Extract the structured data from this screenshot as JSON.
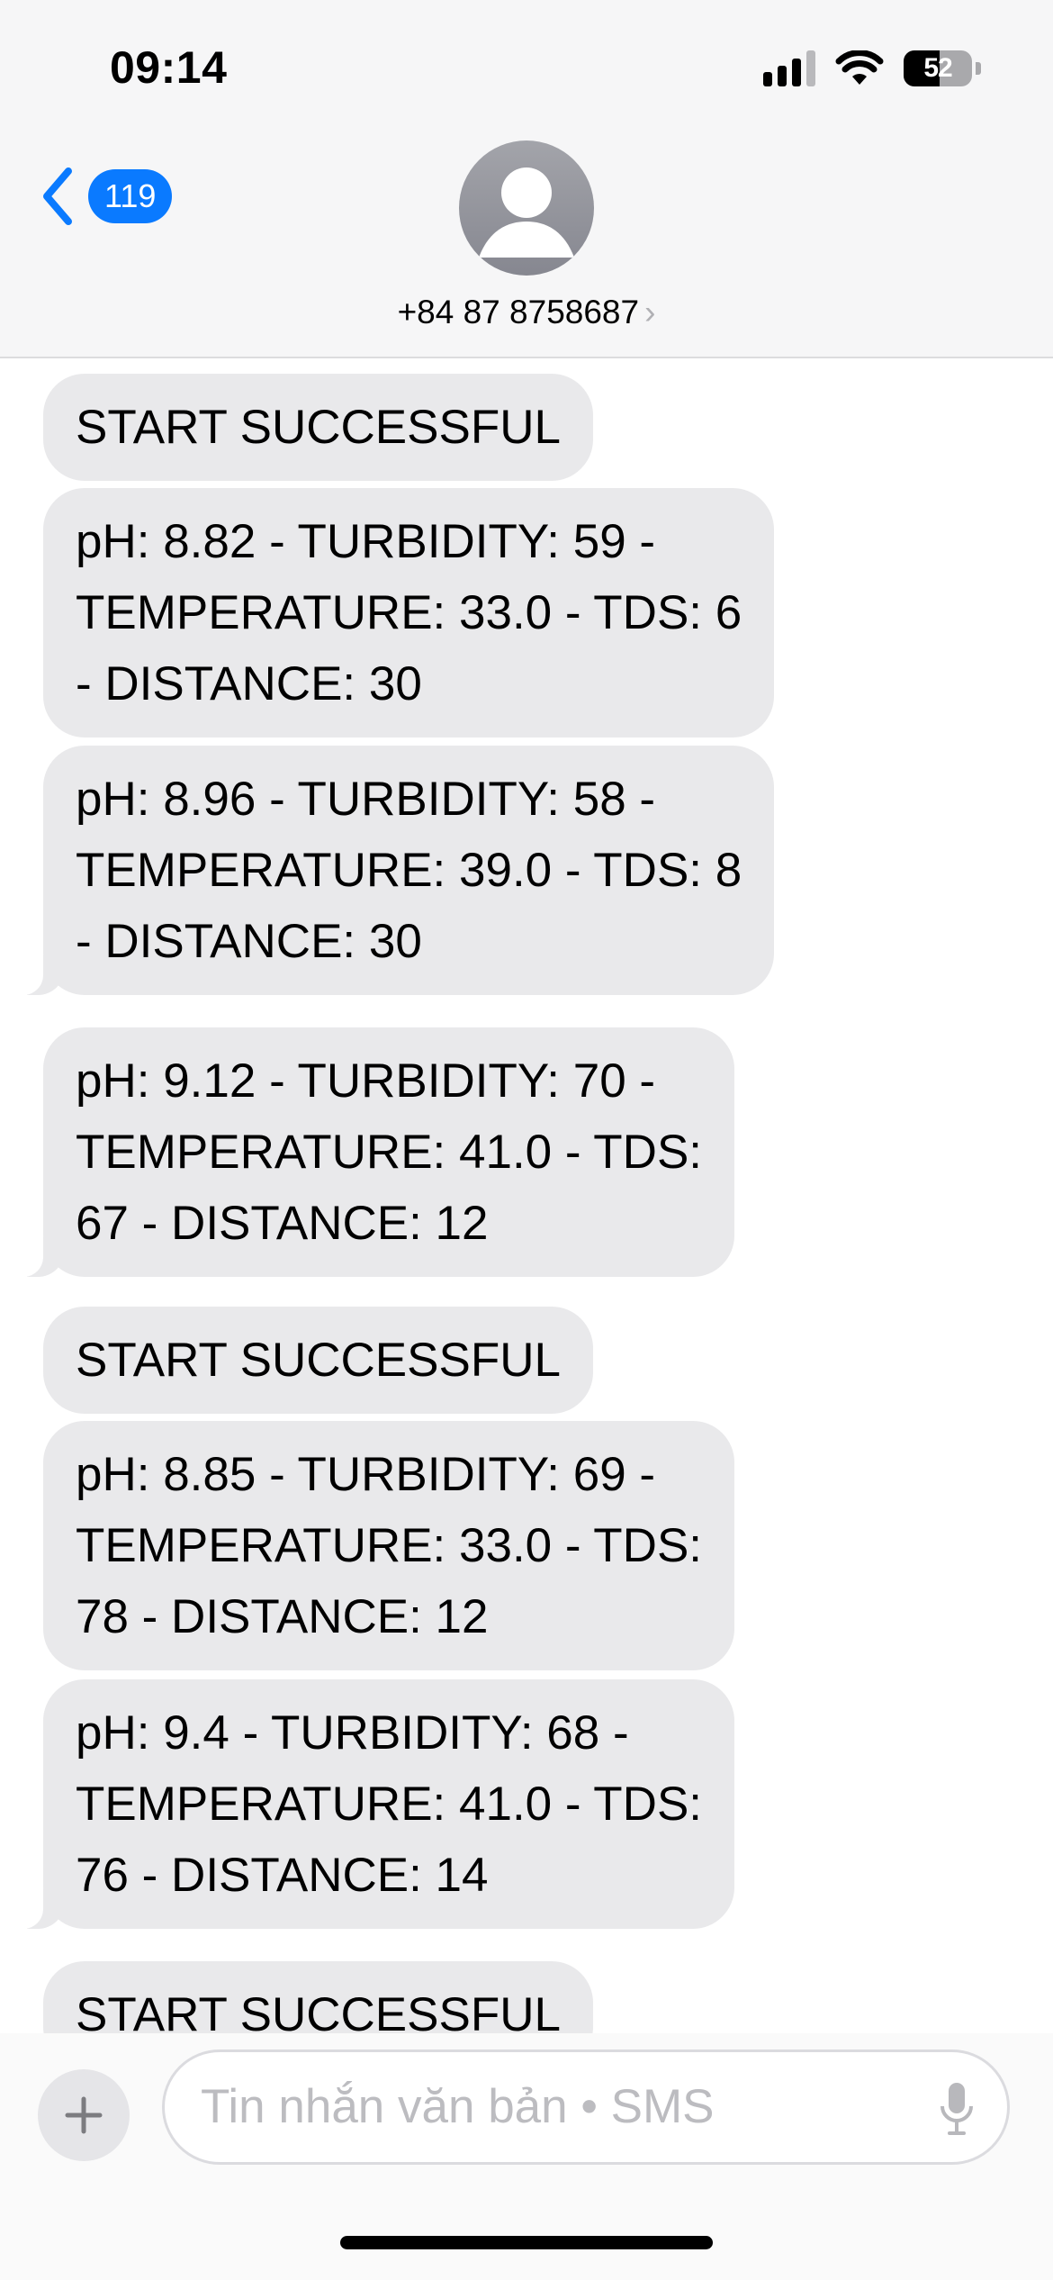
{
  "status_bar": {
    "time": "09:14",
    "battery": "52"
  },
  "header": {
    "back_badge": "119",
    "contact": "+84 87 8758687",
    "chevron": "›"
  },
  "messages": [
    {
      "text": "START SUCCESSFUL"
    },
    {
      "text": "pH: 8.82 - TURBIDITY: 59 -\nTEMPERATURE: 33.0 - TDS: 6\n- DISTANCE: 30"
    },
    {
      "text": "pH: 8.96 - TURBIDITY: 58 -\nTEMPERATURE: 39.0 - TDS: 8\n- DISTANCE: 30"
    },
    {
      "text": "pH: 9.12 - TURBIDITY: 70 -\nTEMPERATURE: 41.0 - TDS:\n67 - DISTANCE: 12"
    },
    {
      "text": "START SUCCESSFUL"
    },
    {
      "text": "pH: 8.85 - TURBIDITY: 69 -\nTEMPERATURE: 33.0 - TDS:\n78 - DISTANCE: 12"
    },
    {
      "text": "pH: 9.4 - TURBIDITY: 68 -\nTEMPERATURE: 41.0 - TDS:\n76 - DISTANCE: 14"
    },
    {
      "text": "START SUCCESSFUL"
    }
  ],
  "composer": {
    "placeholder": "Tin nhắn văn bản • SMS"
  },
  "colors": {
    "accent": "#0a7aff",
    "bubble": "#e9e9eb"
  }
}
